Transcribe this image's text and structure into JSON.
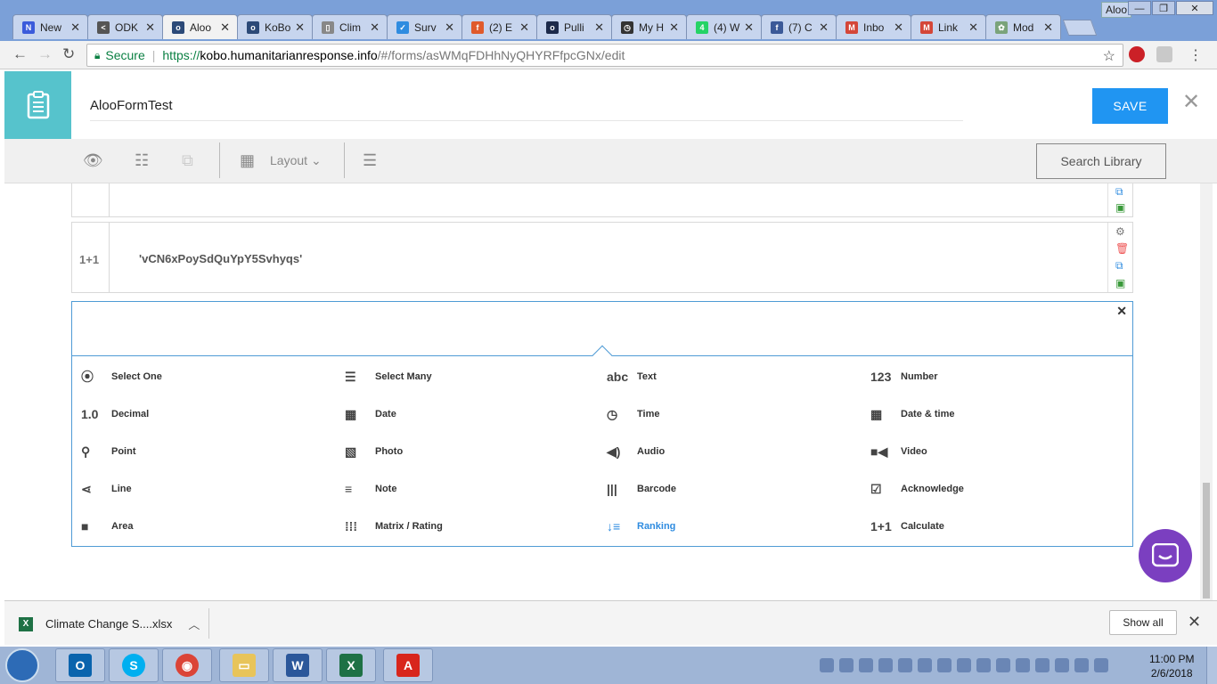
{
  "browser": {
    "profile_name": "Aloo",
    "window_buttons": {
      "minimize": "—",
      "restore": "❐",
      "close": "✕"
    },
    "tabs": [
      {
        "label": "New",
        "color": "#3b5bdb",
        "glyph": "N"
      },
      {
        "label": "ODK",
        "color": "#555555",
        "glyph": "<"
      },
      {
        "label": "Aloo",
        "color": "#2c4a78",
        "glyph": "o",
        "active": true
      },
      {
        "label": "KoBo",
        "color": "#2c4a78",
        "glyph": "o"
      },
      {
        "label": "Clim",
        "color": "#888888",
        "glyph": "▯"
      },
      {
        "label": "Surv",
        "color": "#2f8ce0",
        "glyph": "✓"
      },
      {
        "label": "(2) E",
        "color": "#e05a2b",
        "glyph": "f"
      },
      {
        "label": "Pulli",
        "color": "#1c2a4a",
        "glyph": "o"
      },
      {
        "label": "My H",
        "color": "#333333",
        "glyph": "◷"
      },
      {
        "label": "(4) W",
        "color": "#25d366",
        "glyph": "4"
      },
      {
        "label": "(7) C",
        "color": "#3b5998",
        "glyph": "f"
      },
      {
        "label": "Inbo",
        "color": "#d44638",
        "glyph": "M"
      },
      {
        "label": "Link",
        "color": "#d44638",
        "glyph": "M"
      },
      {
        "label": "Mod",
        "color": "#7aa37a",
        "glyph": "✿"
      }
    ],
    "secure_label": "Secure",
    "url": {
      "scheme": "https://",
      "host": "kobo.humanitarianresponse.info",
      "path": "/#/forms/asWMqFDHhNyQHYRFfpcGNx/edit"
    }
  },
  "header": {
    "form_title": "AlooFormTest",
    "save_label": "SAVE",
    "close_icon": "close-icon"
  },
  "fb_toolbar": {
    "layout_label": "Layout",
    "search_library_label": "Search Library"
  },
  "rows": [
    {
      "type_label": "",
      "question": ""
    },
    {
      "type_label": "1+1",
      "question": "'vCN6xPoySdQuYpY5Svhyqs'"
    }
  ],
  "question_types": [
    {
      "icon": "⦿",
      "label": "Select One"
    },
    {
      "icon": "☰",
      "label": "Select Many"
    },
    {
      "icon": "abc",
      "label": "Text"
    },
    {
      "icon": "123",
      "label": "Number"
    },
    {
      "icon": "1.0",
      "label": "Decimal"
    },
    {
      "icon": "▦",
      "label": "Date"
    },
    {
      "icon": "◷",
      "label": "Time"
    },
    {
      "icon": "▦",
      "label": "Date & time"
    },
    {
      "icon": "⚲",
      "label": "Point"
    },
    {
      "icon": "▧",
      "label": "Photo"
    },
    {
      "icon": "◀)",
      "label": "Audio"
    },
    {
      "icon": "■◀",
      "label": "Video"
    },
    {
      "icon": "⋖",
      "label": "Line"
    },
    {
      "icon": "≡",
      "label": "Note"
    },
    {
      "icon": "|||",
      "label": "Barcode"
    },
    {
      "icon": "☑",
      "label": "Acknowledge"
    },
    {
      "icon": "■",
      "label": "Area"
    },
    {
      "icon": "⁞⁞⁞",
      "label": "Matrix / Rating"
    },
    {
      "icon": "↓≡",
      "label": "Ranking",
      "highlight": true
    },
    {
      "icon": "1+1",
      "label": "Calculate"
    }
  ],
  "downloads": {
    "file_name": "Climate Change S....xlsx",
    "show_all_label": "Show all"
  },
  "taskbar": {
    "time": "11:00 PM",
    "date": "2/6/2018"
  },
  "colors": {
    "accent": "#2095f2",
    "logo_teal": "#56c3cc",
    "picker_border": "#4f9bd5",
    "chat_purple": "#7b3fc0"
  }
}
